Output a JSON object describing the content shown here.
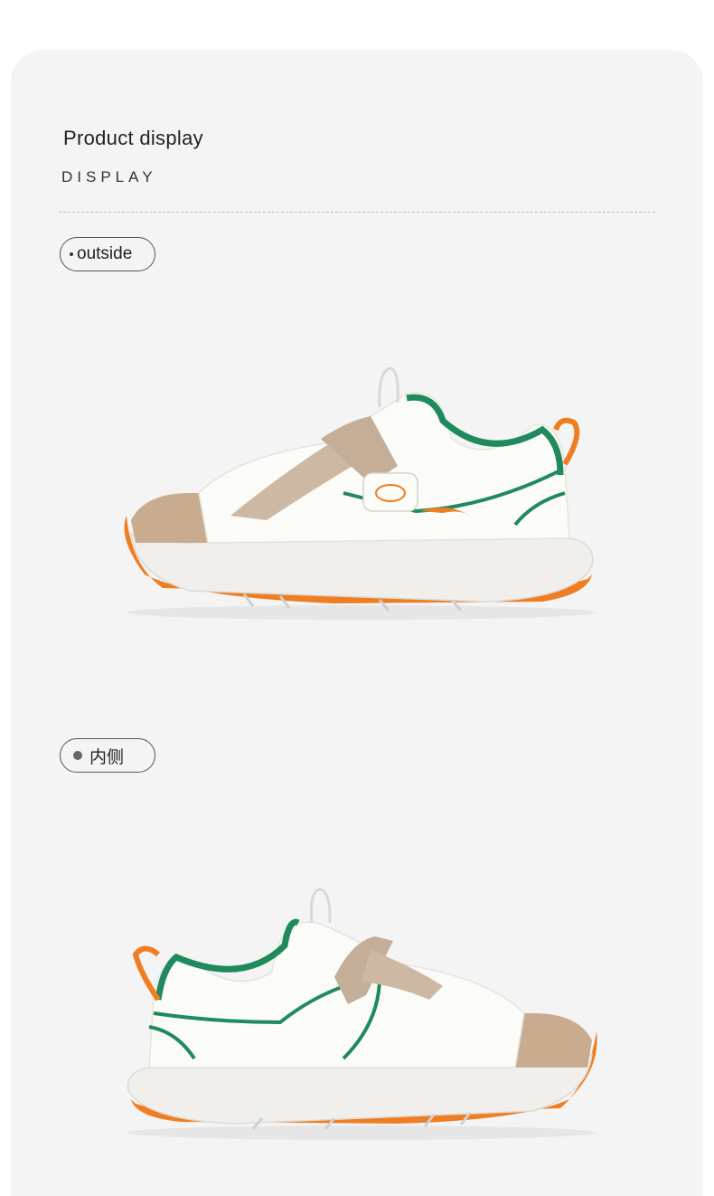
{
  "header": {
    "title": "Product display",
    "subtitle": "DISPLAY"
  },
  "sections": [
    {
      "label": "outside",
      "icon": "dot-icon",
      "image": "sneaker-outside-view"
    },
    {
      "label": "内侧",
      "icon": "dot-icon",
      "image": "sneaker-inside-view"
    }
  ],
  "colors": {
    "background": "#f4f4f4",
    "accent_green": "#1f8a5c",
    "accent_orange": "#ef7d22",
    "strap_tan": "#c9b7a5",
    "upper_white": "#fbfbf8"
  }
}
